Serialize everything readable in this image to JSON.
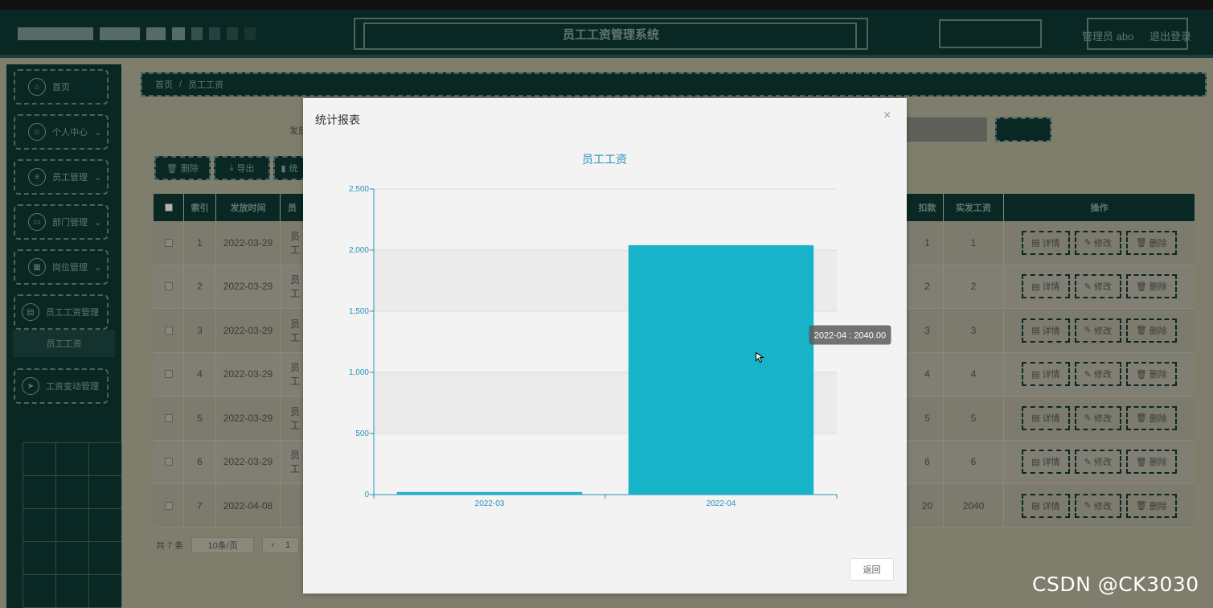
{
  "header": {
    "title": "员工工资管理系统",
    "user": "管理员 abo",
    "logout": "退出登录"
  },
  "sidebar": {
    "items": [
      {
        "label": "首页",
        "icon": "home-icon",
        "glyph": "⌂"
      },
      {
        "label": "个人中心",
        "icon": "user-icon",
        "glyph": "☺"
      },
      {
        "label": "员工管理",
        "icon": "list-icon",
        "glyph": "≡"
      },
      {
        "label": "部门管理",
        "icon": "monitor-icon",
        "glyph": "▭"
      },
      {
        "label": "岗位管理",
        "icon": "grid-icon",
        "glyph": "▦"
      },
      {
        "label": "员工工资管理",
        "icon": "briefcase-icon",
        "glyph": "▤"
      },
      {
        "label": "工资变动管理",
        "icon": "send-icon",
        "glyph": "➤"
      }
    ],
    "active_sub": "员工工资"
  },
  "breadcrumb": {
    "home": "首页",
    "sep": "/",
    "current": "员工工资"
  },
  "filter": {
    "label": "发放"
  },
  "toolbar": {
    "delete": "删除",
    "export": "导出",
    "stats": "统"
  },
  "table": {
    "headers": {
      "index": "索引",
      "date": "发放时间",
      "emp": "员",
      "deduct": "扣款",
      "paid": "实发工资",
      "ops": "操作"
    },
    "rows": [
      {
        "index": "1",
        "date": "2022-03-29",
        "emp": "员工",
        "deduct": "1",
        "paid": "1"
      },
      {
        "index": "2",
        "date": "2022-03-29",
        "emp": "员工",
        "deduct": "2",
        "paid": "2"
      },
      {
        "index": "3",
        "date": "2022-03-29",
        "emp": "员工",
        "deduct": "3",
        "paid": "3"
      },
      {
        "index": "4",
        "date": "2022-03-29",
        "emp": "员工",
        "deduct": "4",
        "paid": "4"
      },
      {
        "index": "5",
        "date": "2022-03-29",
        "emp": "员工",
        "deduct": "5",
        "paid": "5"
      },
      {
        "index": "6",
        "date": "2022-03-29",
        "emp": "员工",
        "deduct": "6",
        "paid": "6"
      },
      {
        "index": "7",
        "date": "2022-04-08",
        "emp": "",
        "deduct": "20",
        "paid": "2040"
      }
    ],
    "ops": {
      "detail": "详情",
      "edit": "修改",
      "delete": "删除"
    }
  },
  "pager": {
    "total": "共 7 条",
    "size": "10条/页",
    "page": "1"
  },
  "dialog": {
    "title": "统计报表",
    "close": "×",
    "back": "返回"
  },
  "chart_data": {
    "type": "bar",
    "title": "员工工资",
    "categories": [
      "2022-03",
      "2022-04"
    ],
    "values": [
      21,
      2040
    ],
    "ylim": [
      0,
      2500
    ],
    "yticks": [
      "0",
      "500",
      "1,000",
      "1,500",
      "2,000",
      "2,500"
    ],
    "ytick_values": [
      0,
      500,
      1000,
      1500,
      2000,
      2500
    ],
    "bar_color": "#17b3c9",
    "axis_color": "#2b8fbf",
    "tooltip": "2022-04 : 2040.00",
    "tooltip_index": 1
  },
  "watermark": "CSDN @CK3030",
  "colors": {
    "primary": "#0d3a33",
    "accent": "#17b3c9"
  }
}
